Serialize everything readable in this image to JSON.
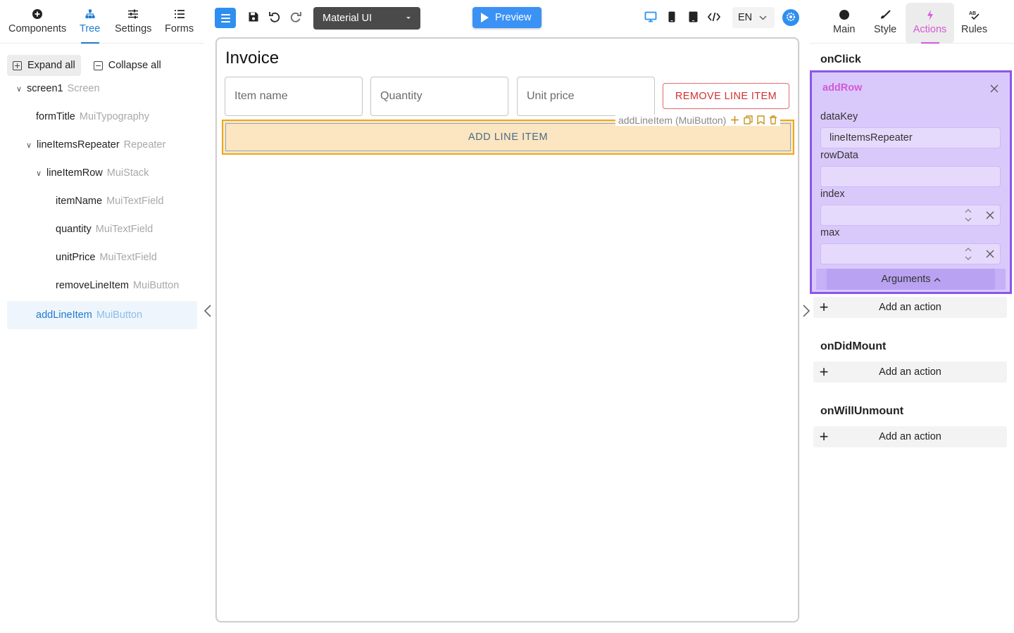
{
  "left_tabs": [
    {
      "label": "Components",
      "icon": "plus-circle-icon"
    },
    {
      "label": "Tree",
      "icon": "tree-icon"
    },
    {
      "label": "Settings",
      "icon": "sliders-icon"
    },
    {
      "label": "Forms",
      "icon": "list-icon"
    }
  ],
  "tree_tools": {
    "expand_all": "Expand all",
    "collapse_all": "Collapse all"
  },
  "tree": [
    {
      "name": "screen1",
      "kind": "Screen"
    },
    {
      "name": "formTitle",
      "kind": "MuiTypography"
    },
    {
      "name": "lineItemsRepeater",
      "kind": "Repeater"
    },
    {
      "name": "lineItemRow",
      "kind": "MuiStack"
    },
    {
      "name": "itemName",
      "kind": "MuiTextField"
    },
    {
      "name": "quantity",
      "kind": "MuiTextField"
    },
    {
      "name": "unitPrice",
      "kind": "MuiTextField"
    },
    {
      "name": "removeLineItem",
      "kind": "MuiButton"
    },
    {
      "name": "addLineItem",
      "kind": "MuiButton"
    }
  ],
  "toolbar": {
    "theme": "Material UI",
    "preview": "Preview",
    "language": "EN",
    "accent": "#2f8ff0"
  },
  "canvas": {
    "title": "Invoice",
    "fields": [
      "Item name",
      "Quantity",
      "Unit price"
    ],
    "remove_button": "REMOVE LINE ITEM",
    "add_button": "ADD LINE ITEM",
    "selection_label": "addLineItem (MuiButton)"
  },
  "right_tabs": [
    {
      "label": "Main",
      "icon": "circle-icon"
    },
    {
      "label": "Style",
      "icon": "brush-icon"
    },
    {
      "label": "Actions",
      "icon": "bolt-icon"
    },
    {
      "label": "Rules",
      "icon": "rules-icon"
    }
  ],
  "events": {
    "on_click": "onClick",
    "on_did_mount": "onDidMount",
    "on_will_unmount": "onWillUnmount"
  },
  "action": {
    "name": "addRow",
    "args": {
      "data_key_label": "dataKey",
      "data_key_value": "lineItemsRepeater",
      "row_data_label": "rowData",
      "row_data_value": "",
      "index_label": "index",
      "index_value": "",
      "max_label": "max",
      "max_value": ""
    },
    "arguments_toggle": "Arguments"
  },
  "add_action_label": "Add an action",
  "colors": {
    "selection": "#f0a617",
    "action_border": "#8b56e8",
    "action_accent": "#d458d8",
    "danger": "#d32f2f"
  }
}
